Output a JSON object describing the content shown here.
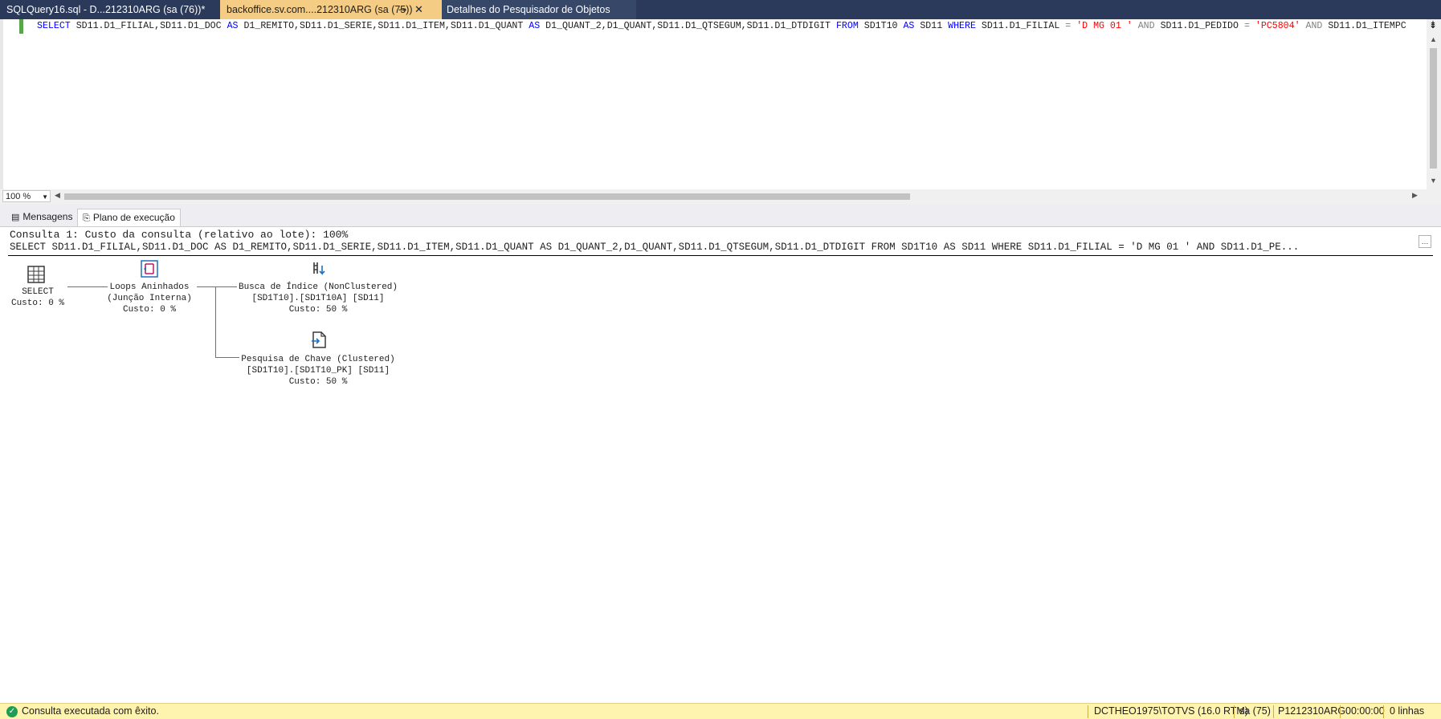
{
  "tabs": [
    {
      "label": "SQLQuery16.sql - D...212310ARG (sa (76))*"
    },
    {
      "label": "backoffice.sv.com....212310ARG (sa (75))"
    },
    {
      "label": "Detalhes do Pesquisador de Objetos"
    }
  ],
  "editor": {
    "sql_parts": [
      {
        "t": "SELECT",
        "k": "kw"
      },
      {
        "t": " SD11.D1_FILIAL,SD11.D1_DOC ",
        "k": ""
      },
      {
        "t": "AS",
        "k": "kw"
      },
      {
        "t": " D1_REMITO,SD11.D1_SERIE,SD11.D1_ITEM,SD11.D1_QUANT ",
        "k": ""
      },
      {
        "t": "AS",
        "k": "kw"
      },
      {
        "t": " D1_QUANT_2,D1_QUANT,SD11.D1_QTSEGUM,SD11.D1_DTDIGIT ",
        "k": ""
      },
      {
        "t": "FROM",
        "k": "kw"
      },
      {
        "t": " SD1T10 ",
        "k": ""
      },
      {
        "t": "AS",
        "k": "kw"
      },
      {
        "t": " SD11 ",
        "k": ""
      },
      {
        "t": "WHERE",
        "k": "kw"
      },
      {
        "t": "  SD11.D1_FILIAL ",
        "k": ""
      },
      {
        "t": "=",
        "k": "gr"
      },
      {
        "t": " 'D MG 01 '",
        "k": "str"
      },
      {
        "t": " AND ",
        "k": "gr"
      },
      {
        "t": "SD11.D1_PEDIDO ",
        "k": ""
      },
      {
        "t": "=",
        "k": "gr"
      },
      {
        "t": " 'PC5804'",
        "k": "str"
      },
      {
        "t": " AND ",
        "k": "gr"
      },
      {
        "t": "SD11.D1_ITEMPC",
        "k": ""
      }
    ]
  },
  "zoom": "100 %",
  "result_tabs": {
    "messages": "Mensagens",
    "plan": "Plano de execução"
  },
  "plan": {
    "header1": "Consulta 1: Custo da consulta (relativo ao lote): 100%",
    "header2": "SELECT SD11.D1_FILIAL,SD11.D1_DOC AS D1_REMITO,SD11.D1_SERIE,SD11.D1_ITEM,SD11.D1_QUANT AS D1_QUANT_2,D1_QUANT,SD11.D1_QTSEGUM,SD11.D1_DTDIGIT FROM SD1T10 AS SD11 WHERE SD11.D1_FILIAL = 'D MG 01 ' AND SD11.D1_PE...",
    "nodes": {
      "select": {
        "l1": "SELECT",
        "l2": "Custo: 0 %"
      },
      "loops": {
        "l1": "Loops Aninhados",
        "l2": "(Junção Interna)",
        "l3": "Custo: 0 %"
      },
      "seek": {
        "l1": "Busca de Índice (NonClustered)",
        "l2": "[SD1T10].[SD1T10A] [SD11]",
        "l3": "Custo: 50 %"
      },
      "lookup": {
        "l1": "Pesquisa de Chave (Clustered)",
        "l2": "[SD1T10].[SD1T10_PK] [SD11]",
        "l3": "Custo: 50 %"
      }
    }
  },
  "status": {
    "message": "Consulta executada com êxito.",
    "server": "DCTHEO1975\\TOTVS (16.0 RTM)",
    "user": "sa (75)",
    "db": "P1212310ARG",
    "time": "00:00:00",
    "rows": "0 linhas"
  }
}
